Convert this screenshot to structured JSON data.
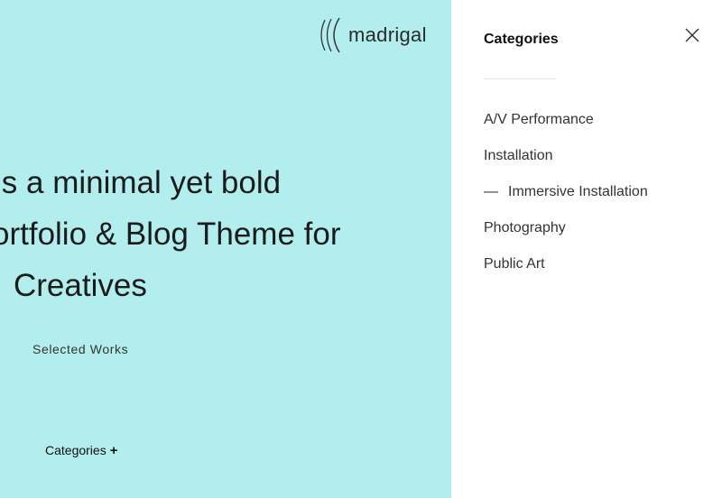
{
  "brand": {
    "logo_text": "madrigal",
    "logo_icon": "sound-waves-logo-icon"
  },
  "hero": {
    "line1": "is a minimal yet bold",
    "line2": "ortfolio & Blog Theme for",
    "line3": "Creatives",
    "selected_works": "Selected Works",
    "categories_toggle": "Categories",
    "toggle_icon": "+"
  },
  "panel": {
    "title": "Categories",
    "close_icon": "close-icon",
    "items": [
      {
        "label": "A/V Performance",
        "prefix": ""
      },
      {
        "label": "Installation",
        "prefix": ""
      },
      {
        "label": "Immersive Installation",
        "prefix": "—"
      },
      {
        "label": "Photography",
        "prefix": ""
      },
      {
        "label": "Public Art",
        "prefix": ""
      }
    ]
  },
  "colors": {
    "accent_background": "#b2eeee",
    "text": "#1b1b1b",
    "panel_background": "#ffffff"
  }
}
